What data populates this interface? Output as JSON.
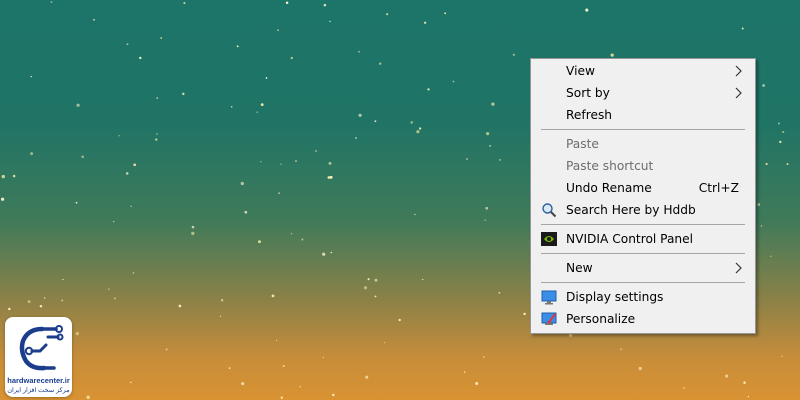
{
  "desktop": {
    "background": "green-to-orange starry wallpaper"
  },
  "context_menu": {
    "items": [
      {
        "label": "View",
        "submenu": true
      },
      {
        "label": "Sort by",
        "submenu": true
      },
      {
        "label": "Refresh"
      },
      {
        "label": "Paste",
        "disabled": true
      },
      {
        "label": "Paste shortcut",
        "disabled": true
      },
      {
        "label": "Undo Rename",
        "shortcut": "Ctrl+Z"
      },
      {
        "label": "Search Here by Hddb",
        "icon": "search-icon"
      },
      {
        "label": "NVIDIA Control Panel",
        "icon": "nvidia-icon"
      },
      {
        "label": "New",
        "submenu": true
      },
      {
        "label": "Display settings",
        "icon": "display-icon"
      },
      {
        "label": "Personalize",
        "icon": "personalize-icon"
      }
    ]
  },
  "logo": {
    "brand": "hardwarecenter.ir",
    "subtitle": "مرکز سخت افزار ایران"
  }
}
